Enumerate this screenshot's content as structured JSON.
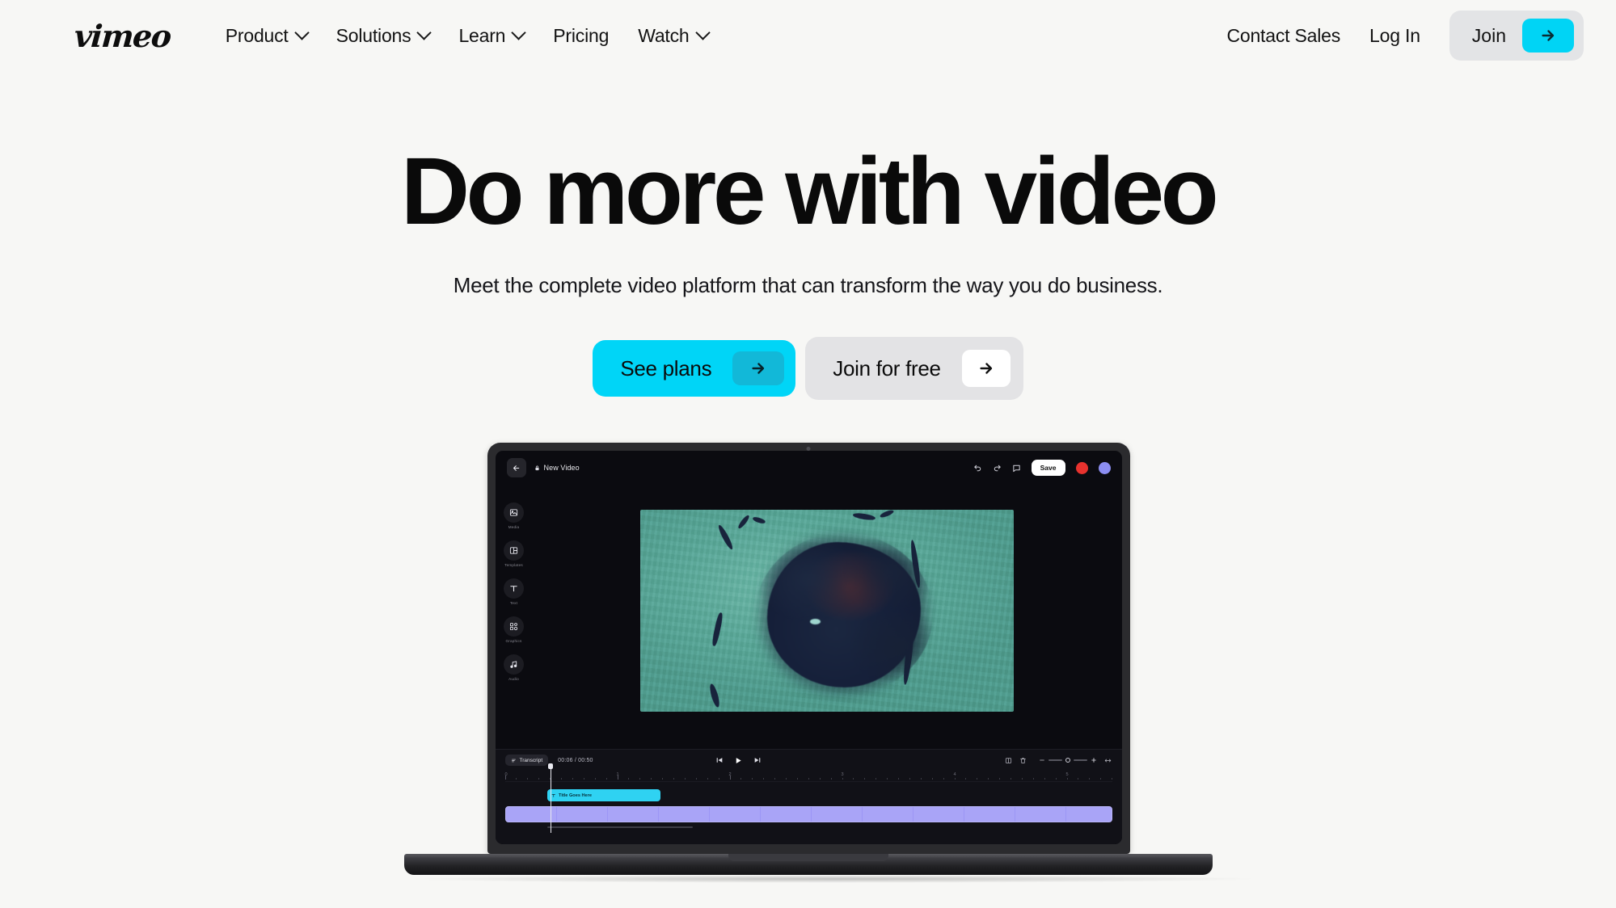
{
  "brand": {
    "logo_text": "vimeo",
    "accent": "#00d4f5",
    "accent_dark": "#12b8d8",
    "chip_bg": "#e3e4e6"
  },
  "nav": {
    "items": [
      {
        "label": "Product",
        "has_chevron": true,
        "icon": "chevron-down-icon"
      },
      {
        "label": "Solutions",
        "has_chevron": true,
        "icon": "chevron-down-icon"
      },
      {
        "label": "Learn",
        "has_chevron": true,
        "icon": "chevron-down-icon"
      },
      {
        "label": "Pricing",
        "has_chevron": false,
        "icon": ""
      },
      {
        "label": "Watch",
        "has_chevron": true,
        "icon": "chevron-down-icon"
      }
    ],
    "contact_sales": "Contact Sales",
    "log_in": "Log In",
    "join": "Join",
    "join_arrow_icon": "arrow-right-icon"
  },
  "hero": {
    "headline": "Do more with video",
    "subhead": "Meet the complete video platform that can transform the way you do business.",
    "cta_primary": {
      "label": "See plans",
      "icon": "arrow-right-icon"
    },
    "cta_secondary": {
      "label": "Join for free",
      "icon": "arrow-right-icon"
    }
  },
  "editor": {
    "back_icon": "arrow-left-icon",
    "lock_icon": "lock-icon",
    "project_title": "New Video",
    "undo_icon": "undo-icon",
    "redo_icon": "redo-icon",
    "comment_icon": "comment-icon",
    "save_label": "Save",
    "avatars": [
      {
        "name": "avatar-red",
        "color": "#e8322e"
      },
      {
        "name": "avatar-purple",
        "color": "#8c8ef2"
      }
    ],
    "rail": [
      {
        "label": "Media",
        "icon": "image-icon"
      },
      {
        "label": "Templates",
        "icon": "layout-icon"
      },
      {
        "label": "Text",
        "icon": "text-icon"
      },
      {
        "label": "Graphics",
        "icon": "shapes-icon"
      },
      {
        "label": "Audio",
        "icon": "music-icon"
      }
    ],
    "timeline": {
      "transcript_label": "Transcript",
      "transcript_icon": "transcript-icon",
      "current_time": "00:06",
      "total_time": "00:50",
      "time_display": "00:06 / 00:50",
      "transport": [
        {
          "name": "skip-back-button",
          "icon": "skip-back-icon"
        },
        {
          "name": "play-button",
          "icon": "play-icon"
        },
        {
          "name": "skip-forward-button",
          "icon": "skip-forward-icon"
        }
      ],
      "split_icon": "split-icon",
      "delete_icon": "trash-icon",
      "zoom_out_icon": "minus-icon",
      "zoom_in_icon": "plus-icon",
      "fit_icon": "fit-to-width-icon",
      "ruler_labels": [
        "0",
        "1",
        "2",
        "3",
        "4",
        "5"
      ],
      "text_clip": {
        "label": "Title Goes Here",
        "icon": "text-icon",
        "color": "#2fd2f2"
      },
      "video_clip": {
        "color": "#a9a4f7"
      }
    }
  }
}
